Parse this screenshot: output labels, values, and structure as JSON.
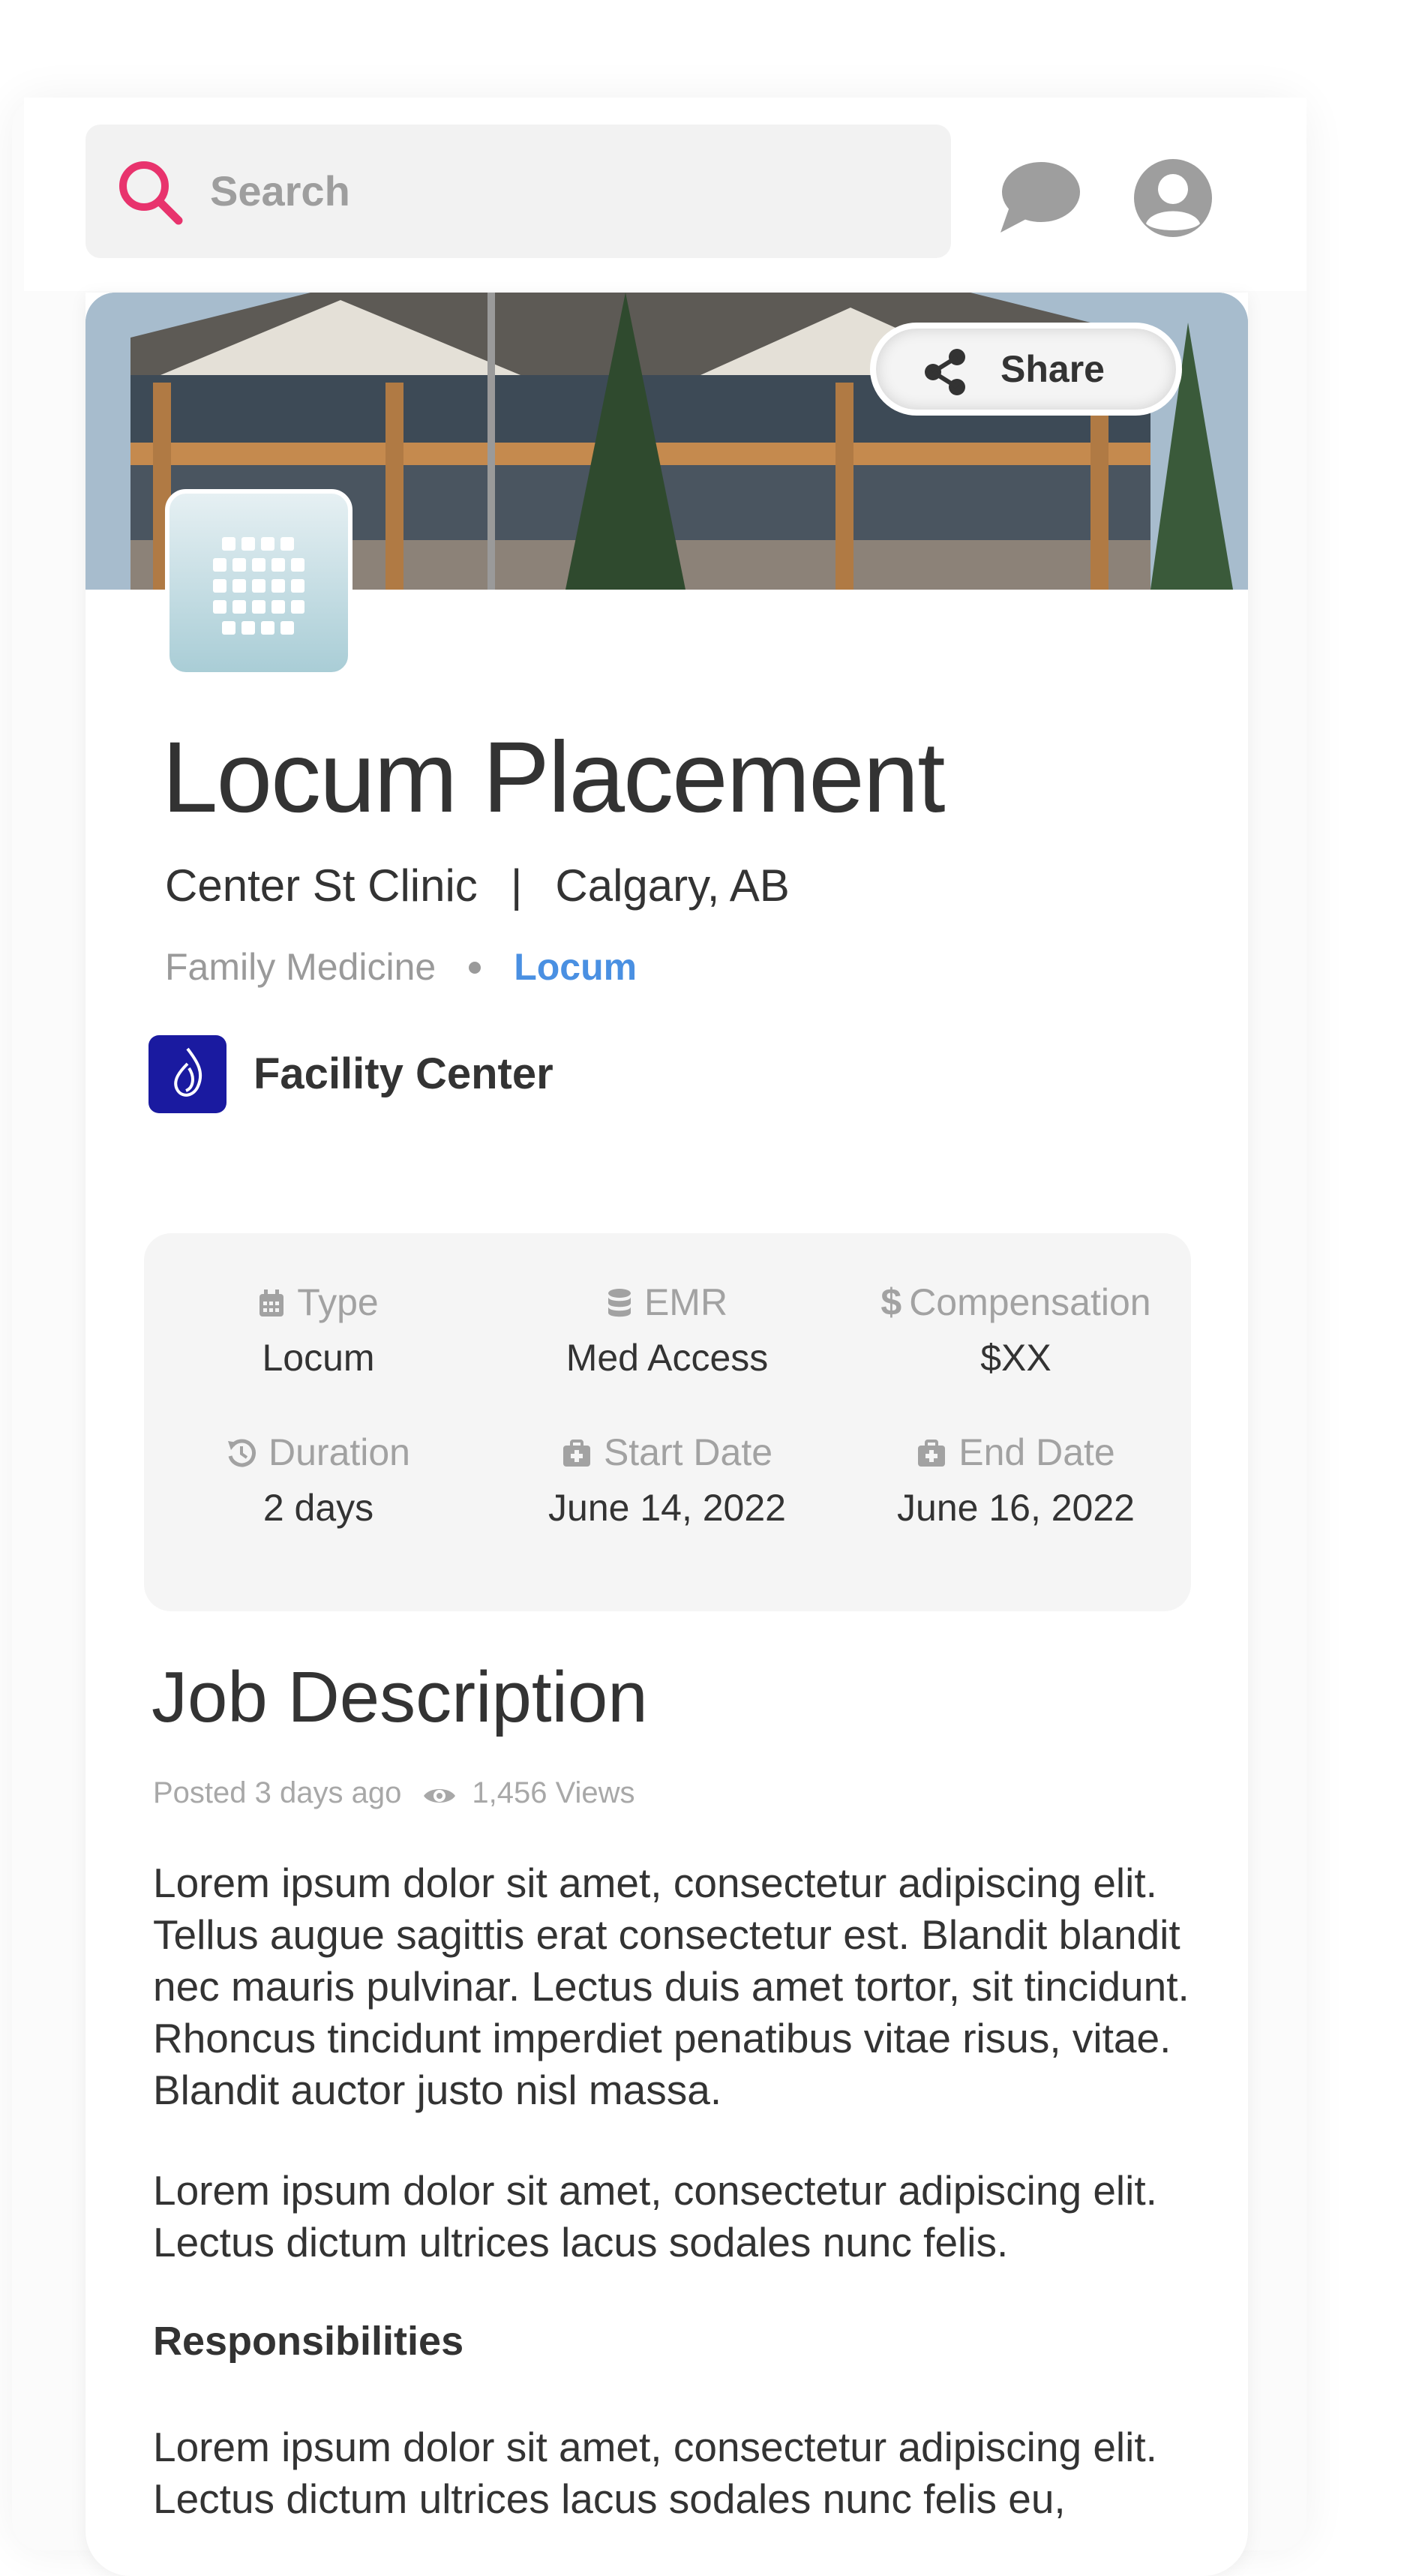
{
  "header": {
    "search_placeholder": "Search",
    "icons": [
      "search-icon",
      "chat-icon",
      "account-icon"
    ],
    "accent_color": "#e8336d"
  },
  "share": {
    "label": "Share"
  },
  "job": {
    "title": "Locum Placement",
    "clinic": "Center St Clinic",
    "separator": "|",
    "location": "Calgary, AB",
    "specialty": "Family Medicine",
    "placement_type": "Locum",
    "placement_color": "#4a90e2",
    "facility": "Facility Center"
  },
  "details": {
    "type": {
      "label": "Type",
      "value": "Locum",
      "icon": "calendar-icon"
    },
    "emr": {
      "label": "EMR",
      "value": "Med Access",
      "icon": "database-icon"
    },
    "compensation": {
      "label": "Compensation",
      "value": "$XX",
      "icon": "dollar-icon"
    },
    "duration": {
      "label": "Duration",
      "value": "2 days",
      "icon": "history-icon"
    },
    "start_date": {
      "label": "Start Date",
      "value": "June 14, 2022",
      "icon": "medical-kit-icon"
    },
    "end_date": {
      "label": "End Date",
      "value": "June 16, 2022",
      "icon": "medical-kit-icon"
    }
  },
  "description": {
    "heading": "Job Description",
    "posted": "Posted 3 days ago",
    "views": "1,456 Views",
    "paragraph1": "Lorem ipsum dolor sit amet, consectetur adipiscing elit. Tellus augue sagittis erat consectetur est. Blandit blandit nec mauris pulvinar. Lectus duis amet tortor, sit tincidunt. Rhoncus tincidunt imperdiet penatibus vitae risus, vitae. Blandit auctor justo nisl massa.",
    "paragraph2": "Lorem ipsum dolor sit amet, consectetur adipiscing elit. Lectus dictum ultrices lacus sodales nunc felis.",
    "responsibilities_heading": "Responsibilities",
    "paragraph3": "Lorem ipsum dolor sit amet, consectetur adipiscing elit. Lectus dictum ultrices lacus sodales nunc felis eu,"
  }
}
